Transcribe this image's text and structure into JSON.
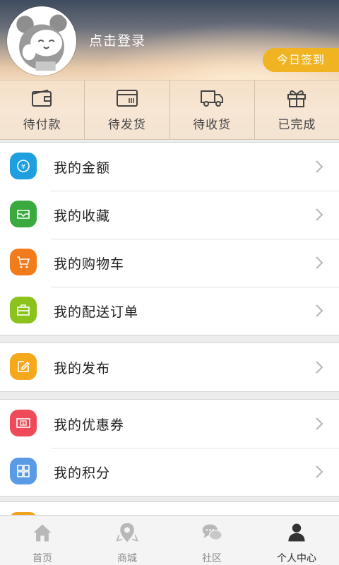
{
  "header": {
    "login_text": "点击登录",
    "checkin_label": "今日签到"
  },
  "orders": [
    {
      "label": "待付款",
      "icon": "wallet-icon"
    },
    {
      "label": "待发货",
      "icon": "package-icon"
    },
    {
      "label": "待收货",
      "icon": "truck-icon"
    },
    {
      "label": "已完成",
      "icon": "gift-icon"
    }
  ],
  "menu": {
    "group1": [
      {
        "label": "我的金额",
        "icon": "yuan-coin-icon",
        "color": "#1e9fe0"
      },
      {
        "label": "我的收藏",
        "icon": "collection-tray-icon",
        "color": "#3aaa3f"
      },
      {
        "label": "我的购物车",
        "icon": "shopping-cart-icon",
        "color": "#f27c1b"
      },
      {
        "label": "我的配送订单",
        "icon": "briefcase-icon",
        "color": "#8bc21c"
      }
    ],
    "group2": [
      {
        "label": "我的发布",
        "icon": "edit-icon",
        "color": "#f6a81c"
      }
    ],
    "group3": [
      {
        "label": "我的优惠券",
        "icon": "coupon-icon",
        "color": "#ee4a5a"
      },
      {
        "label": "我的积分",
        "icon": "grid-icon",
        "color": "#5a9be6"
      }
    ]
  },
  "tabbar": [
    {
      "label": "首页",
      "icon": "home-icon",
      "active": false
    },
    {
      "label": "商城",
      "icon": "map-pin-icon",
      "active": false
    },
    {
      "label": "社区",
      "icon": "chat-bubbles-icon",
      "active": false
    },
    {
      "label": "个人中心",
      "icon": "person-icon",
      "active": true
    }
  ],
  "colors": {
    "accent": "#f0b321",
    "tab_active": "#222222",
    "tab_inactive": "#8a8a8a"
  }
}
